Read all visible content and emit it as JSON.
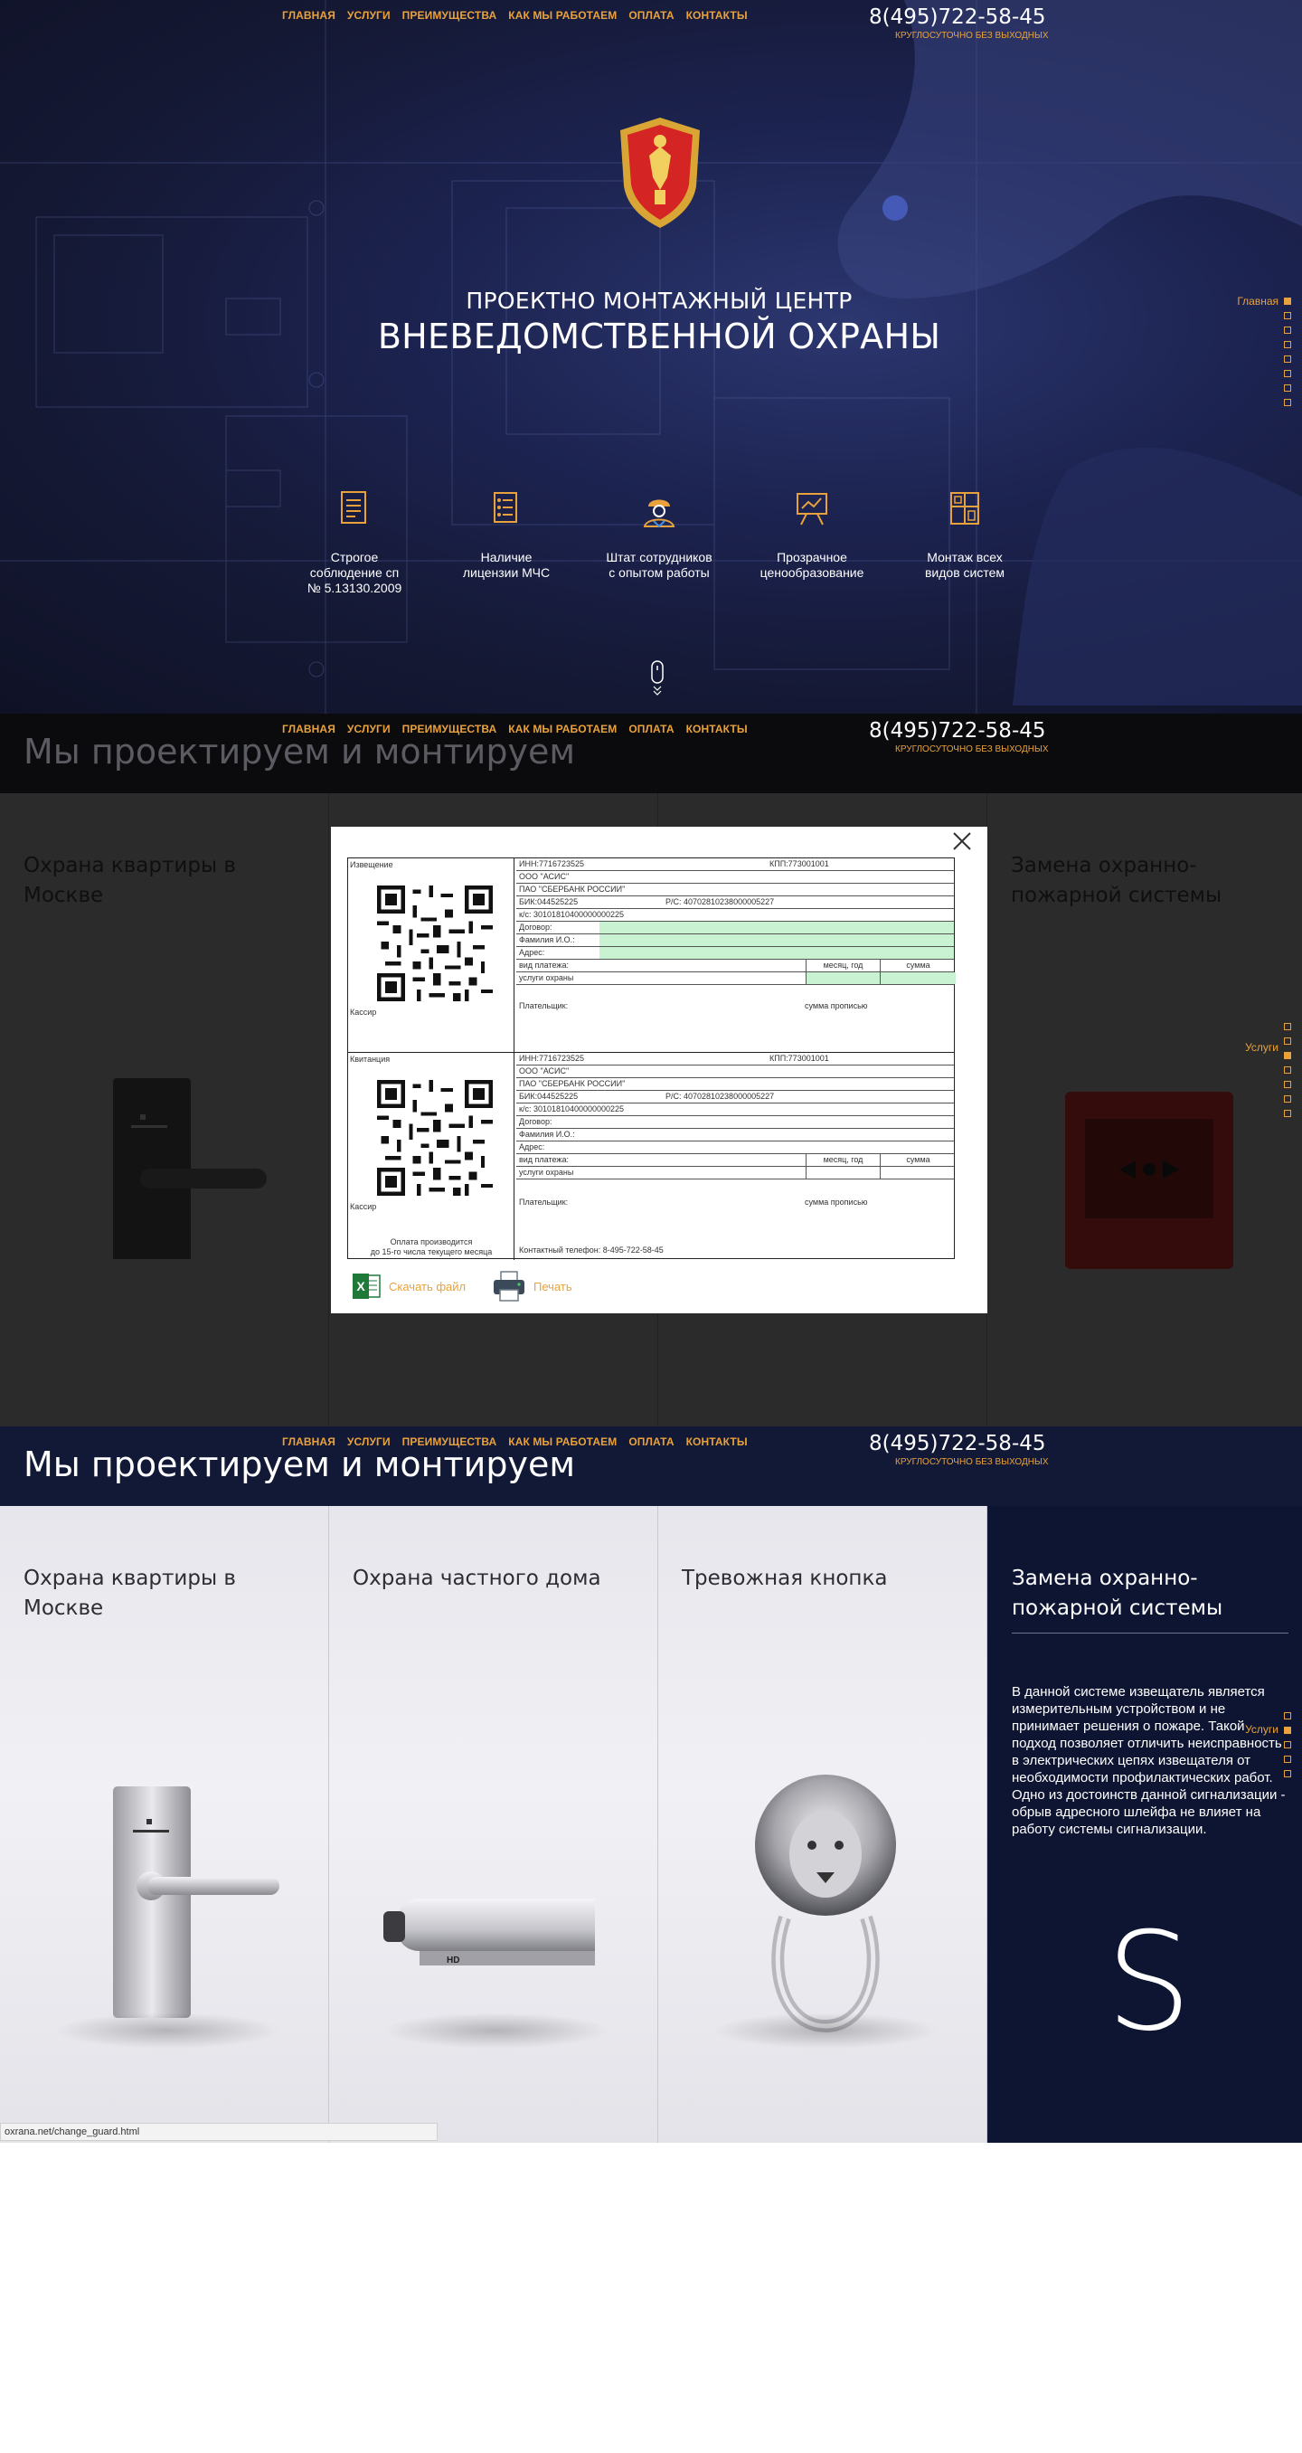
{
  "nav": {
    "items": [
      "ГЛАВНАЯ",
      "УСЛУГИ",
      "ПРЕИМУЩЕСТВА",
      "КАК МЫ РАБОТАЕМ",
      "ОПЛАТА",
      "КОНТАКТЫ"
    ],
    "phone": "8(495)722-58-45",
    "phone_sub": "КРУГЛОСУТОЧНО БЕЗ ВЫХОДНЫХ"
  },
  "hero": {
    "title_line1": "ПРОЕКТНО МОНТАЖНЫЙ ЦЕНТР",
    "title_line2": "ВНЕВЕДОМСТВЕННОЙ ОХРАНЫ",
    "features": [
      {
        "icon": "document-icon",
        "text": "Строгое\nсоблюдение сп\n№ 5.13130.2009"
      },
      {
        "icon": "license-icon",
        "text": "Наличие\nлицензии МЧС"
      },
      {
        "icon": "worker-icon",
        "text": "Штат сотрудников\nс опытом работы"
      },
      {
        "icon": "presentation-icon",
        "text": "Прозрачное\nценообразование"
      },
      {
        "icon": "blueprint-icon",
        "text": "Монтаж всех\nвидов систем"
      }
    ],
    "side_label": "Главная"
  },
  "services_section": {
    "headline": "Мы проектируем и монтируем",
    "side_label": "Услуги",
    "cards": [
      {
        "title": "Охрана квартиры в Москве"
      },
      {
        "title": "Охрана частного дома"
      },
      {
        "title": "Тревожная кнопка"
      },
      {
        "title": "Замена охранно-пожарной системы"
      }
    ],
    "active_description": "В данной системе извещатель является измерительным устройством и не принимает решения о пожаре. Такой подход позволяет отличить неисправность в электрических цепях извещателя от необходимости профилактических работ. Одно из достоинств данной сигнализации - обрыв адресного шлейфа не влияет на работу системы сигнализации.",
    "active_letter": "S",
    "status_url": "oxrana.net/change_guard.html"
  },
  "receipt": {
    "notice_label": "Извещение",
    "receipt_label": "Квитанция",
    "cashier": "Кассир",
    "note": "Оплата производится\nдо 15-го числа текущего месяца",
    "inn": "ИНН:7716723525",
    "kpp": "КПП:773001001",
    "org": "ООО \"АСИС\"",
    "bank": "ПАО \"СБЕРБАНК РОССИИ\"",
    "bik": "БИК:044525225",
    "rs": "Р/С: 40702810238000005227",
    "ks": "к/с: 30101810400000000225",
    "contract": "Договор:",
    "name": "Фамилия И.О.:",
    "address": "Адрес:",
    "payment_type": "вид платежа:",
    "service": "услуги охраны",
    "month_year": "месяц, год",
    "amount": "сумма",
    "payer": "Плательщик:",
    "amount_words": "сумма прописью",
    "contact": "Контактный телефон: 8-495-722-58-45"
  },
  "modal": {
    "download_label": "Скачать файл",
    "print_label": "Печать"
  },
  "colors": {
    "accent": "#e9a23b",
    "hero_bg": "#1c2350",
    "active_card_bg": "#0e1533",
    "fill_green": "#c9f2d3"
  }
}
